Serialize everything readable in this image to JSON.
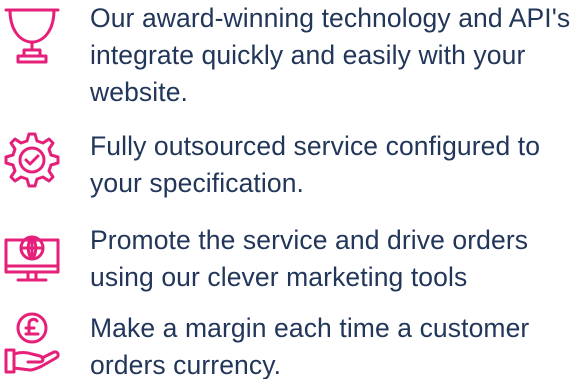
{
  "accent_color": "#e6207a",
  "text_color": "#22365a",
  "features": [
    {
      "icon": "trophy-icon",
      "text": "Our award-winning technology and API's integrate quickly and easily with your website."
    },
    {
      "icon": "gear-check-icon",
      "text": "Fully outsourced service configured to your specification."
    },
    {
      "icon": "globe-monitor-icon",
      "text": "Promote the service and drive orders using our clever marketing tools"
    },
    {
      "icon": "pound-hand-icon",
      "text": "Make a margin each time a customer orders currency."
    }
  ]
}
